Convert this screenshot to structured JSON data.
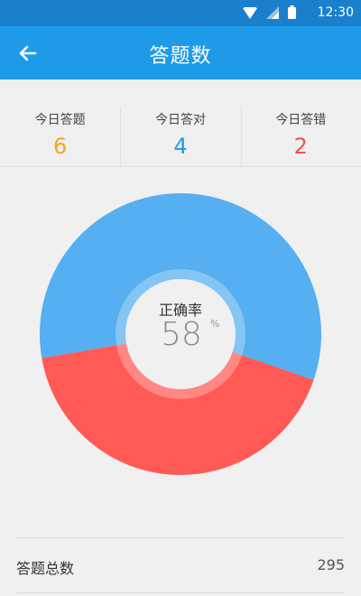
{
  "status_bar": {
    "time": "12:30",
    "icons": [
      "wifi-icon",
      "cell-signal-icon",
      "battery-icon"
    ]
  },
  "app_bar": {
    "title": "答题数",
    "back_icon": "arrow-left-icon"
  },
  "stats": [
    {
      "label": "今日答题",
      "value": "6",
      "color": "#f5a623"
    },
    {
      "label": "今日答对",
      "value": "4",
      "color": "#1e9be8"
    },
    {
      "label": "今日答错",
      "value": "2",
      "color": "#ef5350"
    }
  ],
  "chart_data": {
    "type": "pie",
    "center_label": "正确率",
    "center_value": "58",
    "center_unit": "%",
    "slices": [
      {
        "value": 58,
        "color": "#55aff0"
      },
      {
        "value": 42,
        "color": "#ff5a55"
      }
    ]
  },
  "totals": {
    "label": "答题总数",
    "value": "295"
  }
}
